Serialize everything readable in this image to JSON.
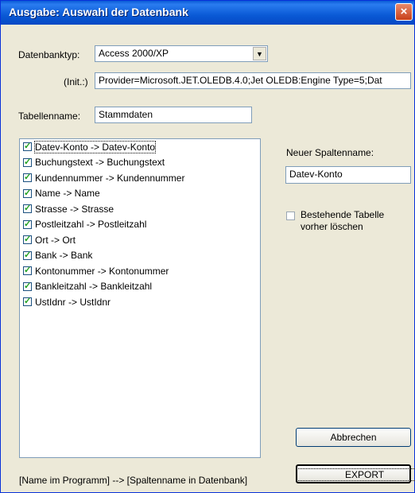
{
  "window": {
    "title": "Ausgabe: Auswahl der Datenbank",
    "close_label": "×"
  },
  "form": {
    "datenbanktyp_label": "Datenbanktyp:",
    "datenbanktyp_value": "Access 2000/XP",
    "init_label": "(Init.:)",
    "init_value": "Provider=Microsoft.JET.OLEDB.4.0;Jet OLEDB:Engine Type=5;Dat",
    "tabellenname_label": "Tabellenname:",
    "tabellenname_value": "Stammdaten"
  },
  "mapping_list": {
    "items": [
      {
        "label": "Datev-Konto -> Datev-Konto",
        "checked": true,
        "selected": true
      },
      {
        "label": "Buchungstext -> Buchungstext",
        "checked": true
      },
      {
        "label": "Kundennummer -> Kundennummer",
        "checked": true
      },
      {
        "label": "Name -> Name",
        "checked": true
      },
      {
        "label": "Strasse -> Strasse",
        "checked": true
      },
      {
        "label": "Postleitzahl -> Postleitzahl",
        "checked": true
      },
      {
        "label": "Ort -> Ort",
        "checked": true
      },
      {
        "label": "Bank -> Bank",
        "checked": true
      },
      {
        "label": "Kontonummer -> Kontonummer",
        "checked": true
      },
      {
        "label": "Bankleitzahl -> Bankleitzahl",
        "checked": true
      },
      {
        "label": "UstIdnr -> UstIdnr",
        "checked": true
      }
    ],
    "legend": "[Name im Programm] --> [Spaltenname in Datenbank]"
  },
  "side_panel": {
    "neuer_spaltenname_label": "Neuer Spaltenname:",
    "neuer_spaltenname_value": "Datev-Konto",
    "delete_table_label_line1": "Bestehende Tabelle",
    "delete_table_label_line2": "vorher löschen",
    "delete_table_checked": false
  },
  "buttons": {
    "cancel_label": "Abbrechen",
    "export_label": "EXPORT"
  }
}
